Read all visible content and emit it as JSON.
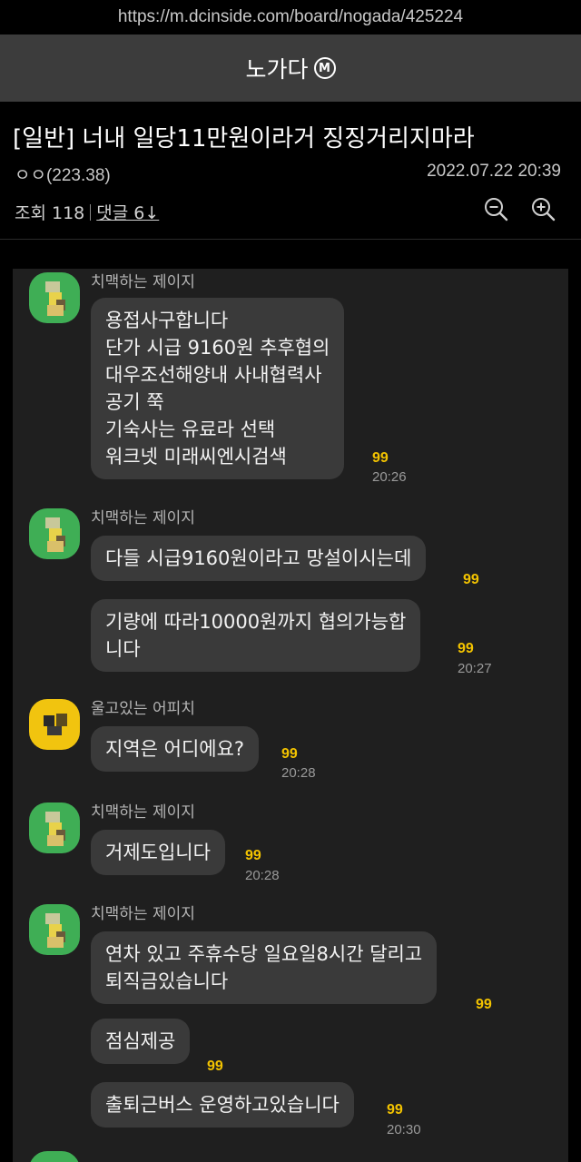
{
  "url": "https://m.dcinside.com/board/nogada/425224",
  "gallery": {
    "title": "노가다",
    "badge": "M"
  },
  "post": {
    "title": "[일반] 너내 일당11만원이라거 징징거리지마라",
    "author": "ㅇㅇ(223.38)",
    "date": "2022.07.22 20:39",
    "views": "조회 118",
    "comments": "댓글 6↓"
  },
  "chat": {
    "groups": [
      {
        "sender": "치맥하는 제이지",
        "avatar": "green",
        "messages": [
          {
            "text": "용접사구합니다\n단가 시급 9160원 추후협의\n대우조선해양내 사내협력사\n공기 쭉\n기숙사는 유료라 선택\n워크넷 미래씨엔시검색",
            "read": "99",
            "time": "20:26"
          }
        ]
      },
      {
        "sender": "치맥하는 제이지",
        "avatar": "green",
        "messages": [
          {
            "text": "다들 시급9160원이라고 망설이시는데",
            "read": "99",
            "time": ""
          },
          {
            "text": "기량에 따라10000원까지 협의가능합\n니다",
            "read": "99",
            "time": "20:27"
          }
        ]
      },
      {
        "sender": "울고있는 어피치",
        "avatar": "yellow",
        "messages": [
          {
            "text": "지역은 어디에요?",
            "read": "99",
            "time": "20:28"
          }
        ]
      },
      {
        "sender": "치맥하는 제이지",
        "avatar": "green",
        "messages": [
          {
            "text": "거제도입니다",
            "read": "99",
            "time": "20:28"
          }
        ]
      },
      {
        "sender": "치맥하는 제이지",
        "avatar": "green",
        "messages": [
          {
            "text": "연차 있고 주휴수당 일요일8시간 달리고\n퇴직금있습니다",
            "read": "99",
            "time": ""
          },
          {
            "text": "점심제공",
            "read": "99",
            "time": ""
          },
          {
            "text": "출퇴근버스 운영하고있습니다",
            "read": "99",
            "time": "20:30"
          }
        ]
      }
    ]
  },
  "colors": {
    "accent_read": "#f3c300",
    "bubble": "#3a3a3a",
    "chat_bg": "#1f1f1f",
    "header": "#3c3c3c"
  },
  "icons": [
    "zoom-out-icon",
    "zoom-in-icon",
    "mail-badge-icon"
  ]
}
